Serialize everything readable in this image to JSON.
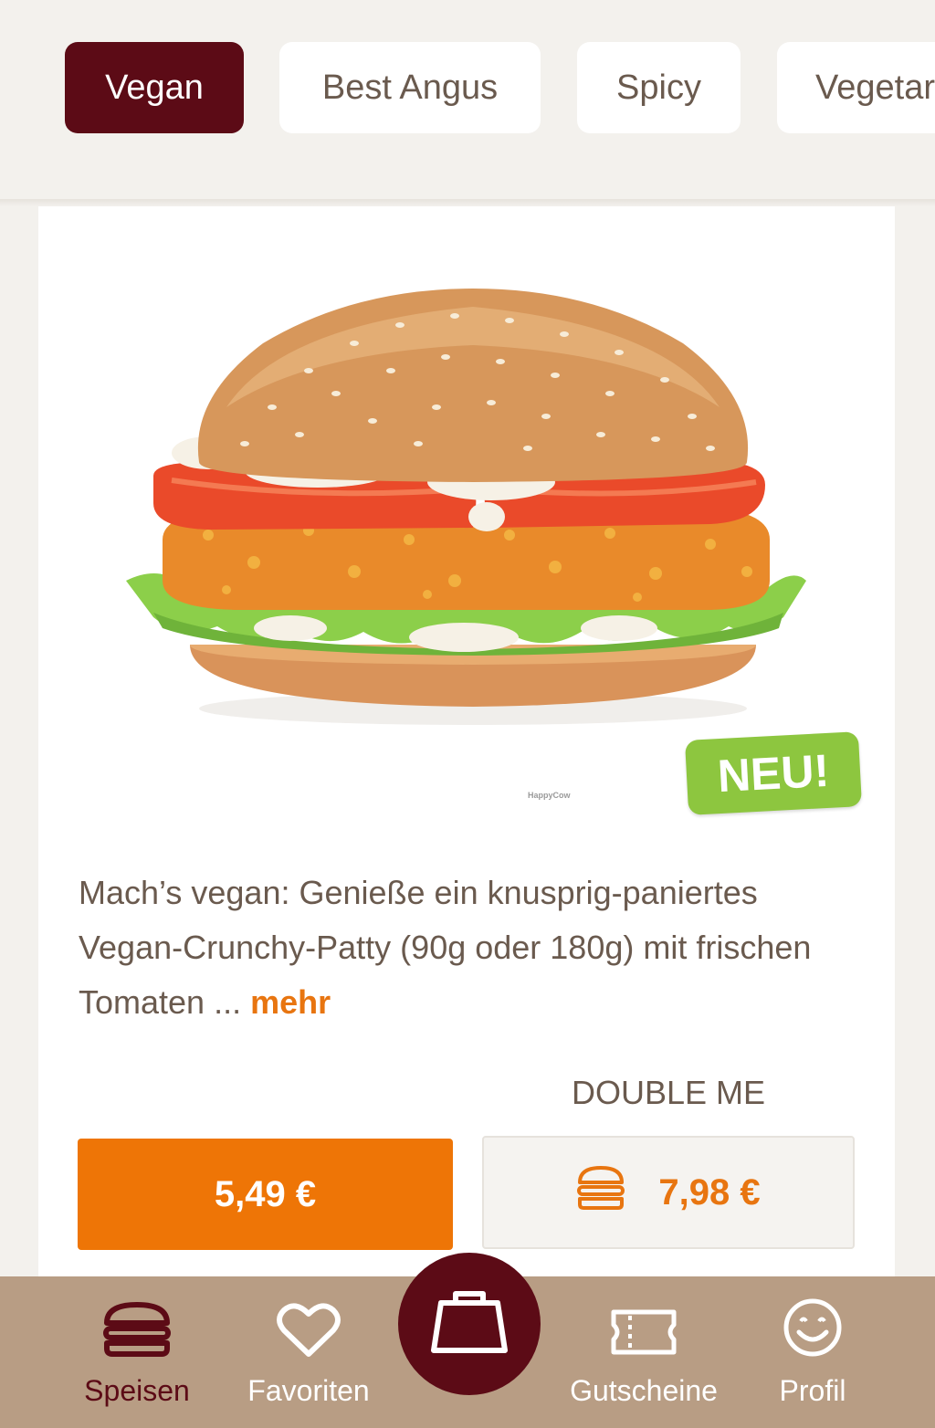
{
  "categories": [
    {
      "label": "Vegan",
      "active": true
    },
    {
      "label": "Best Angus",
      "active": false
    },
    {
      "label": "Spicy",
      "active": false
    },
    {
      "label": "Vegetar",
      "active": false
    }
  ],
  "product": {
    "badge": "NEU!",
    "image_watermark": "HappyCow",
    "description": "Mach’s vegan: Genieße ein knusprig-paniertes Vegan-Crunchy-Patty (90g oder 180g) mit frischen Tomaten",
    "ellipsis": "...",
    "more_label": "mehr",
    "double_label": "DOUBLE ME",
    "price": "5,49 €",
    "double_price": "7,98 €"
  },
  "bottom_nav": {
    "items": [
      {
        "label": "Speisen",
        "icon": "burger-icon",
        "active": true
      },
      {
        "label": "Favoriten",
        "icon": "heart-icon",
        "active": false
      },
      {
        "label": "Gutscheine",
        "icon": "ticket-icon",
        "active": false
      },
      {
        "label": "Profil",
        "icon": "smiley-icon",
        "active": false
      }
    ],
    "cart_icon": "shopping-bag-icon"
  },
  "colors": {
    "brand_dark": "#5c0b16",
    "accent_orange": "#ee7506",
    "badge_green": "#8dc63f",
    "nav_background": "#b89d84",
    "page_background": "#f3f1ed"
  }
}
